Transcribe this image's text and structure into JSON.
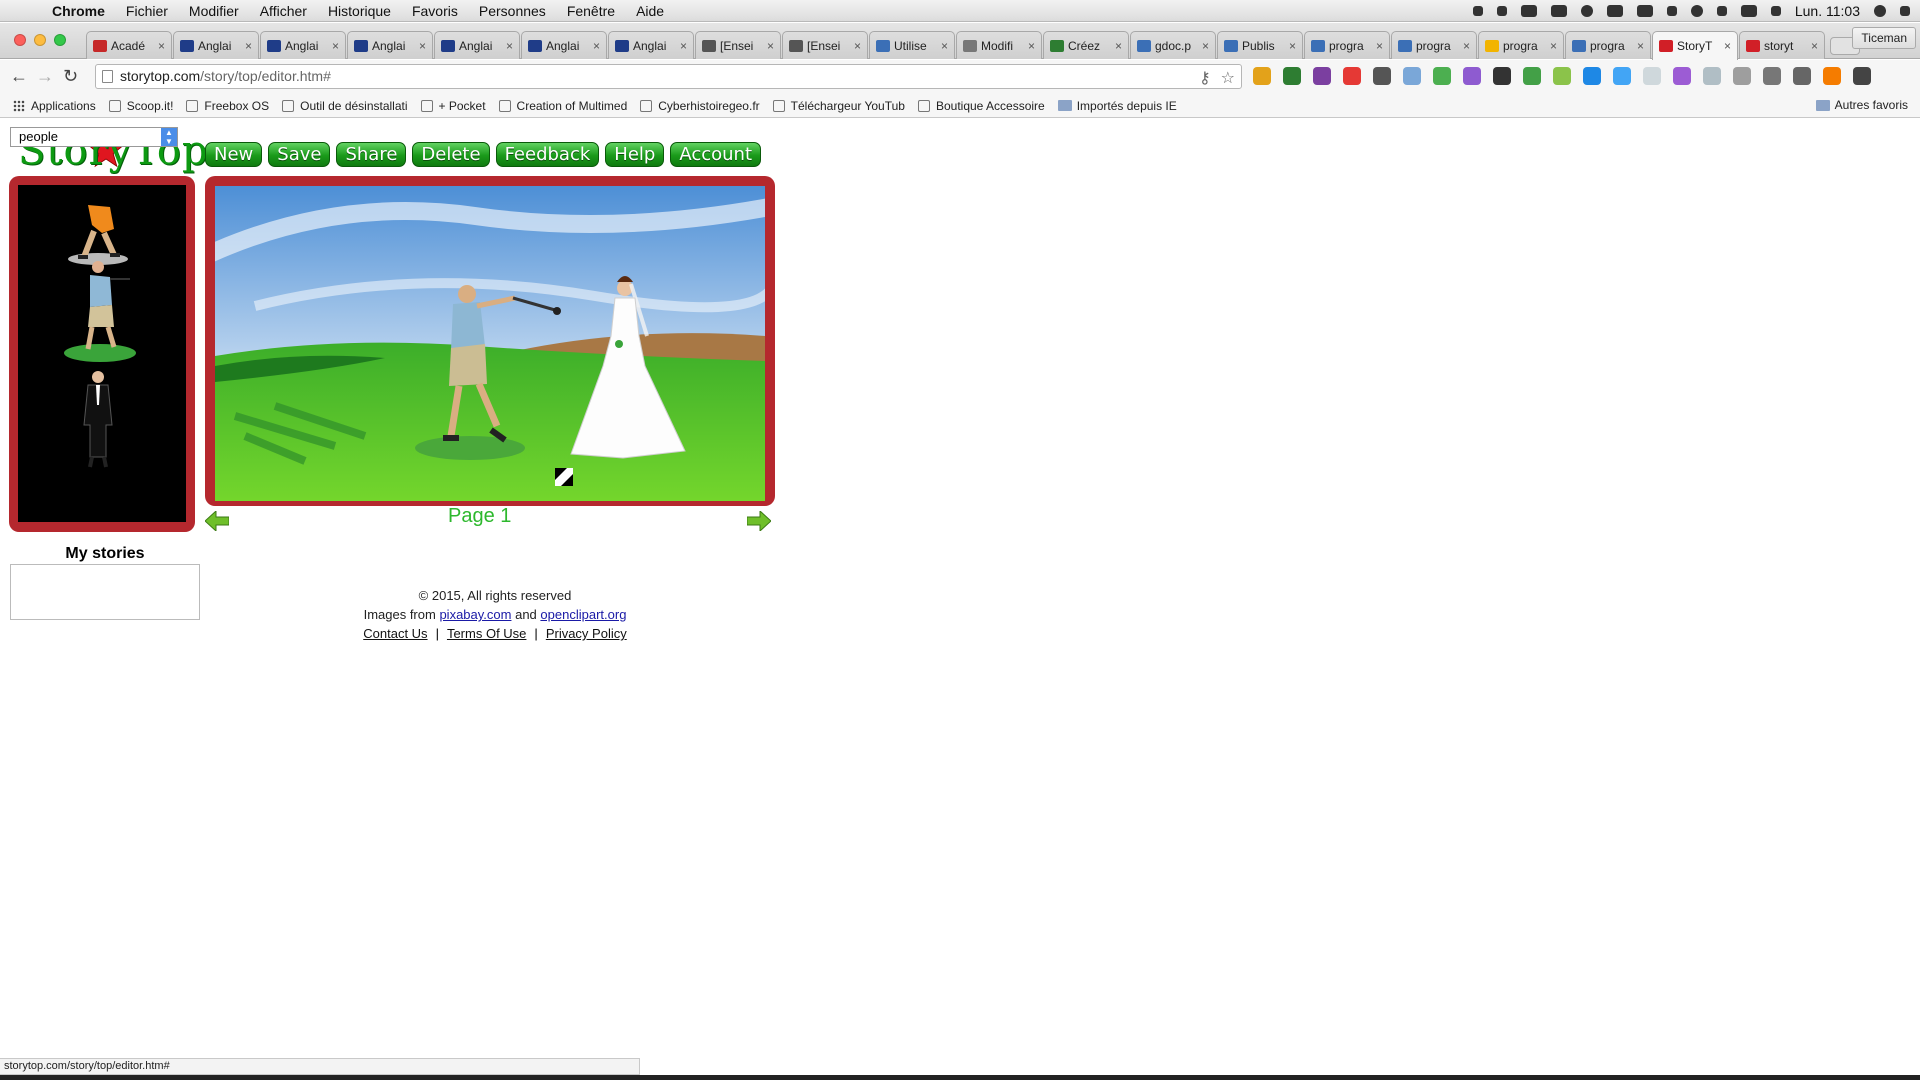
{
  "menubar": {
    "app": "Chrome",
    "items": [
      "Fichier",
      "Modifier",
      "Afficher",
      "Historique",
      "Favoris",
      "Personnes",
      "Fenêtre",
      "Aide"
    ],
    "clock": "Lun. 11:03"
  },
  "tabs": [
    {
      "label": "Acadé",
      "color": "#c62828"
    },
    {
      "label": "Anglai",
      "color": "#1f3c88"
    },
    {
      "label": "Anglai",
      "color": "#1f3c88"
    },
    {
      "label": "Anglai",
      "color": "#1f3c88"
    },
    {
      "label": "Anglai",
      "color": "#1f3c88"
    },
    {
      "label": "Anglai",
      "color": "#1f3c88"
    },
    {
      "label": "Anglai",
      "color": "#1f3c88"
    },
    {
      "label": "[Ensei",
      "color": "#555555"
    },
    {
      "label": "[Ensei",
      "color": "#555555"
    },
    {
      "label": "Utilise",
      "color": "#3b6fb6"
    },
    {
      "label": "Modifi",
      "color": "#777777"
    },
    {
      "label": "Créez",
      "color": "#2e7d32"
    },
    {
      "label": "gdoc.p",
      "color": "#3b6fb6"
    },
    {
      "label": "Publis",
      "color": "#3b6fb6"
    },
    {
      "label": "progra",
      "color": "#3b6fb6"
    },
    {
      "label": "progra",
      "color": "#3b6fb6"
    },
    {
      "label": "progra",
      "color": "#f2b400"
    },
    {
      "label": "progra",
      "color": "#3b6fb6"
    },
    {
      "label": "StoryT",
      "color": "#d11f27",
      "active": true
    },
    {
      "label": "storyt",
      "color": "#d11f27"
    }
  ],
  "profile": "Ticeman",
  "url": {
    "host": "storytop.com",
    "path": "/story/top/editor.htm#"
  },
  "bookmarks": [
    "Applications",
    "Scoop.it!",
    "Freebox OS",
    "Outil de désinstallati",
    "+ Pocket",
    "Creation of Multimed",
    "Cyberhistoiregeo.fr",
    "Téléchargeur YouTub",
    "Boutique Accessoire",
    "Importés depuis IE"
  ],
  "bookmarks_other": "Autres favoris",
  "app": {
    "logo": "StoryTop",
    "buttons": {
      "new": "New",
      "save": "Save",
      "share": "Share",
      "delete": "Delete",
      "feedback": "Feedback",
      "help": "Help",
      "account": "Account"
    },
    "category": "people",
    "page_label": "Page 1",
    "my_stories": "My stories"
  },
  "footer": {
    "copyright": "© 2015, All rights reserved",
    "images_from": "Images from",
    "link1": "pixabay.com",
    "and": "and",
    "link2": "openclipart.org",
    "contact": "Contact Us",
    "terms": "Terms Of Use",
    "privacy": "Privacy Policy"
  },
  "status_url": "storytop.com/story/top/editor.htm#",
  "colors": {
    "frame": "#b5282e",
    "button_green": "#1a9a1a",
    "page_label": "#2db82d"
  }
}
